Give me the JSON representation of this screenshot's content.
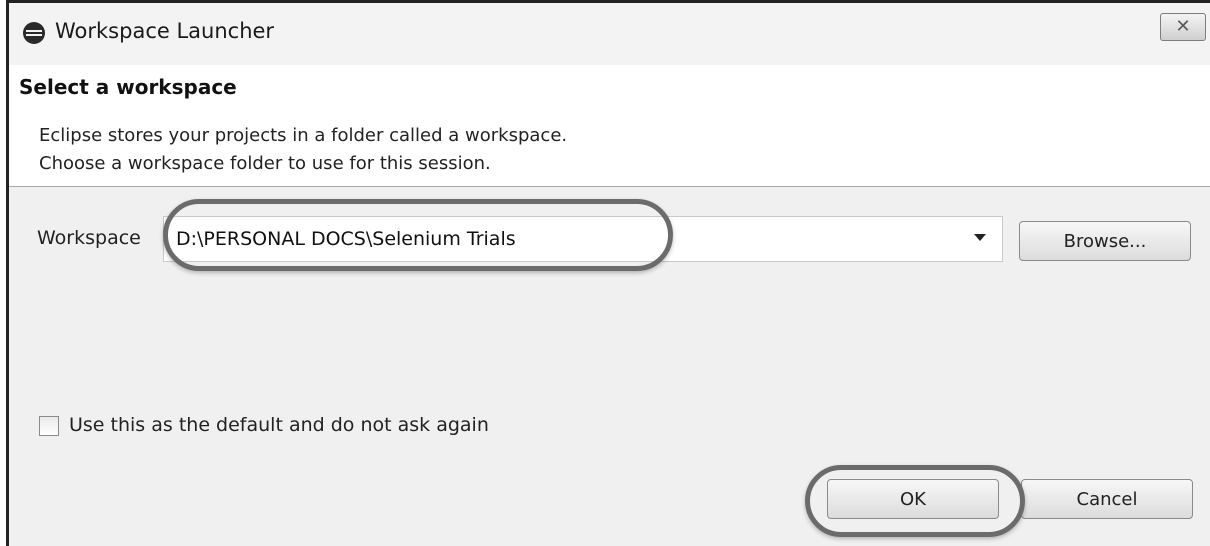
{
  "window": {
    "title": "Workspace Launcher",
    "close_glyph": "✕"
  },
  "banner": {
    "heading": "Select a workspace",
    "line1": "Eclipse stores your projects in a folder called a workspace.",
    "line2": "Choose a workspace folder to use for this session."
  },
  "workspace": {
    "label": "Workspace",
    "value": "D:\\PERSONAL DOCS\\Selenium Trials"
  },
  "buttons": {
    "browse": "Browse...",
    "ok": "OK",
    "cancel": "Cancel"
  },
  "default_checkbox": {
    "label": "Use this as the default and do not ask again",
    "checked": false
  },
  "icons": {
    "app": "eclipse-icon",
    "close": "close-icon",
    "dropdown": "chevron-down-icon"
  },
  "colors": {
    "highlight": "#6b6b6b",
    "dialog_bg": "#f0f0f0",
    "banner_bg": "#ffffff"
  }
}
